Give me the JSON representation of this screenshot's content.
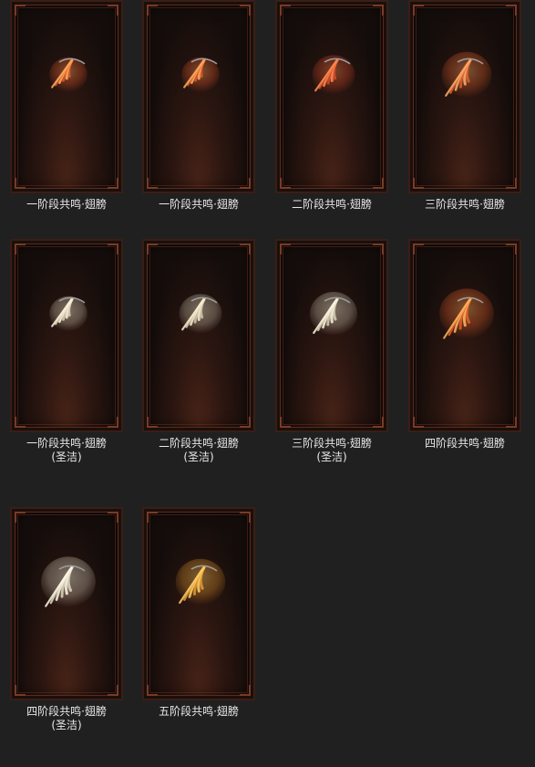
{
  "items": [
    {
      "line1": "一阶段共鸣·翅膀",
      "line2": "",
      "icon": "wing-stage1-icon",
      "color": "#e0582a",
      "glow": "#ffb060",
      "size": 0.8
    },
    {
      "line1": "一阶段共鸣·翅膀",
      "line2": "",
      "icon": "wing-stage1-icon",
      "color": "#e0582a",
      "glow": "#ffb060",
      "size": 0.8
    },
    {
      "line1": "二阶段共鸣·翅膀",
      "line2": "",
      "icon": "wing-stage2-icon",
      "color": "#d84a2a",
      "glow": "#ff9050",
      "size": 0.9
    },
    {
      "line1": "三阶段共鸣·翅膀",
      "line2": "",
      "icon": "wing-stage3-icon",
      "color": "#e0602a",
      "glow": "#ffb070",
      "size": 1.05
    },
    {
      "line1": "一阶段共鸣·翅膀",
      "line2": "(圣洁)",
      "icon": "wing-stage1-holy-icon",
      "color": "#d8d0b8",
      "glow": "#fff4dc",
      "size": 0.8
    },
    {
      "line1": "二阶段共鸣·翅膀",
      "line2": "(圣洁)",
      "icon": "wing-stage2-holy-icon",
      "color": "#d0c8b0",
      "glow": "#fff0d0",
      "size": 0.9
    },
    {
      "line1": "三阶段共鸣·翅膀",
      "line2": "(圣洁)",
      "icon": "wing-stage3-holy-icon",
      "color": "#d8d0b8",
      "glow": "#fff8e0",
      "size": 1.0
    },
    {
      "line1": "四阶段共鸣·翅膀",
      "line2": "",
      "icon": "wing-stage4-icon",
      "color": "#e8602a",
      "glow": "#ffb860",
      "size": 1.15
    },
    {
      "line1": "四阶段共鸣·翅膀",
      "line2": "(圣洁)",
      "icon": "wing-stage4-holy-icon",
      "color": "#e0d8c0",
      "glow": "#fffae8",
      "size": 1.15
    },
    {
      "line1": "五阶段共鸣·翅膀",
      "line2": "",
      "icon": "wing-stage5-icon",
      "color": "#e89a2a",
      "glow": "#ffd070",
      "size": 1.05
    }
  ]
}
